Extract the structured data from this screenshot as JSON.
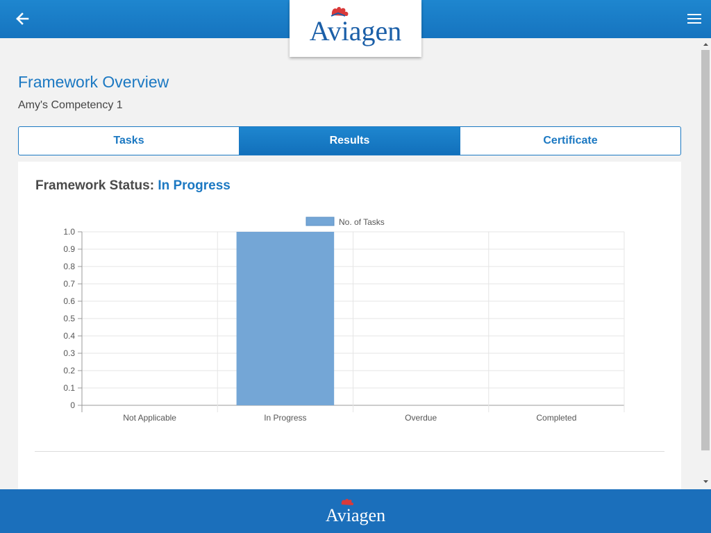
{
  "header": {
    "logo_text": "Aviagen",
    "icons": {
      "back": "arrow-left-icon",
      "menu": "hamburger-menu-icon",
      "logo": "rooster-comb-icon"
    },
    "colors": {
      "bar": "#1674bf",
      "accent": "#1b78c2",
      "comb": "#d93a3a"
    }
  },
  "page": {
    "title": "Framework Overview",
    "subtitle": "Amy's Competency 1"
  },
  "tabs": [
    {
      "label": "Tasks",
      "active": false
    },
    {
      "label": "Results",
      "active": true
    },
    {
      "label": "Certificate",
      "active": false
    }
  ],
  "status": {
    "label": "Framework Status:",
    "value": "In Progress"
  },
  "chart_data": {
    "type": "bar",
    "categories": [
      "Not Applicable",
      "In Progress",
      "Overdue",
      "Completed"
    ],
    "series": [
      {
        "name": "No. of Tasks",
        "values": [
          0,
          1,
          0,
          0
        ],
        "color": "#74a6d6"
      }
    ],
    "ylim": [
      0,
      1
    ],
    "yticks": [
      "1.0",
      "0.9",
      "0.8",
      "0.7",
      "0.6",
      "0.5",
      "0.4",
      "0.3",
      "0.2",
      "0.1",
      "0"
    ],
    "grid": true,
    "legend": "top-center"
  },
  "footer": {
    "logo_text": "Aviagen"
  }
}
